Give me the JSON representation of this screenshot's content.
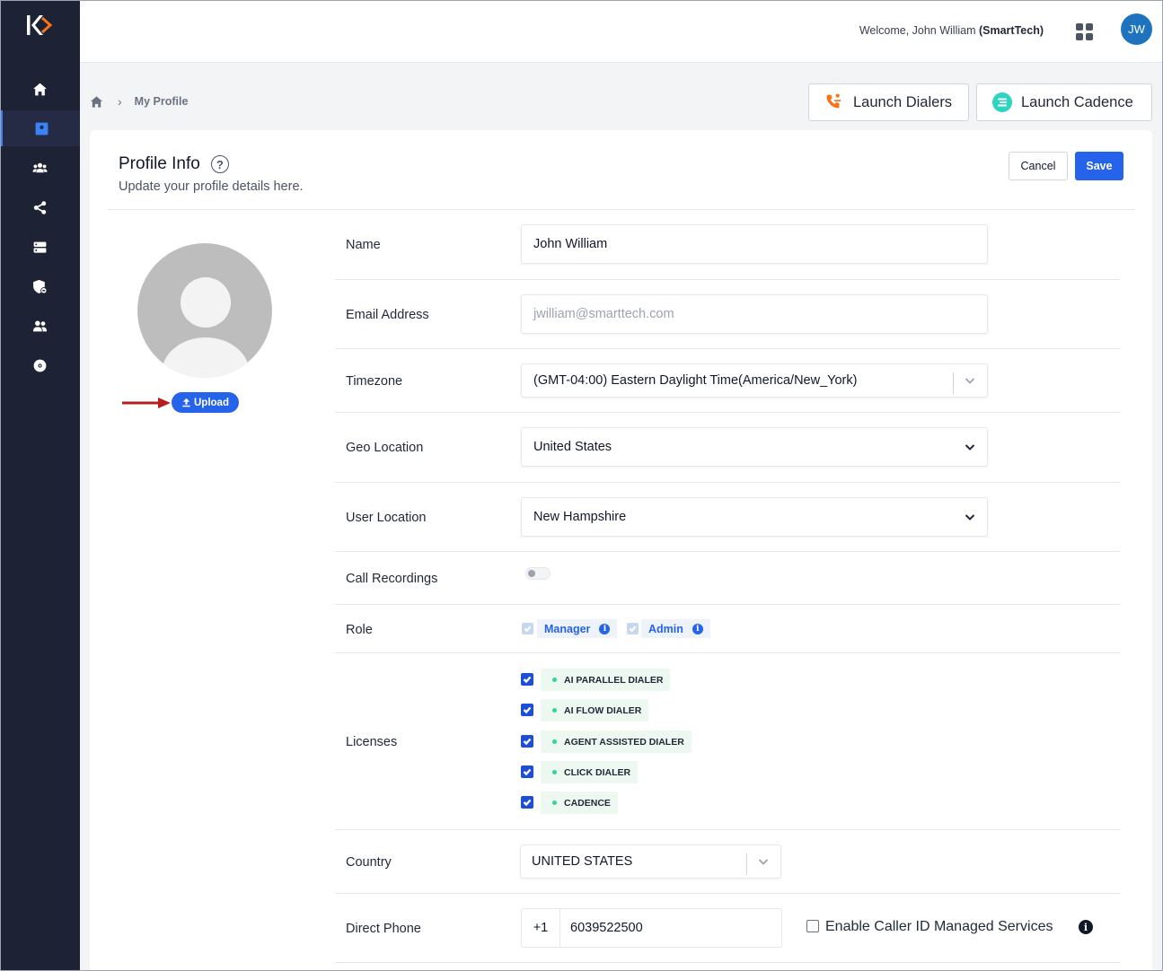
{
  "header": {
    "welcome_prefix": "Welcome, John William ",
    "welcome_org": "(SmartTech)",
    "avatar_initials": "JW"
  },
  "sidebar": {
    "items": [
      {
        "icon": "home-icon"
      },
      {
        "icon": "profile-icon",
        "active": true
      },
      {
        "icon": "users-group-icon"
      },
      {
        "icon": "share-icon"
      },
      {
        "icon": "server-icon"
      },
      {
        "icon": "shield-icon"
      },
      {
        "icon": "team-icon"
      },
      {
        "icon": "disc-icon"
      }
    ]
  },
  "breadcrumb": {
    "current": "My Profile"
  },
  "actions": {
    "launch_dialers": "Launch Dialers",
    "launch_cadence": "Launch Cadence",
    "cancel": "Cancel",
    "save": "Save"
  },
  "profile": {
    "title": "Profile Info",
    "help": "?",
    "subtitle": "Update your profile details here.",
    "upload_label": "Upload"
  },
  "form": {
    "name_label": "Name",
    "name_value": "John William",
    "email_label": "Email Address",
    "email_value": "jwilliam@smarttech.com",
    "timezone_label": "Timezone",
    "timezone_value": "(GMT-04:00) Eastern Daylight Time(America/New_York)",
    "geo_label": "Geo Location",
    "geo_value": "United States",
    "user_location_label": "User Location",
    "user_location_value": "New Hampshire",
    "call_recordings_label": "Call Recordings",
    "call_recordings_enabled": false,
    "role_label": "Role",
    "roles": [
      "Manager",
      "Admin"
    ],
    "licenses_label": "Licenses",
    "licenses": [
      "AI PARALLEL DIALER",
      "AI FLOW DIALER",
      "AGENT ASSISTED DIALER",
      "CLICK DIALER",
      "CADENCE"
    ],
    "country_label": "Country",
    "country_value": "UNITED STATES",
    "direct_phone_label": "Direct Phone",
    "phone_prefix": "+1",
    "phone_value": "6039522500",
    "caller_id_label": "Enable Caller ID Managed Services",
    "caller_id_checked": false
  },
  "colors": {
    "sidebar_bg": "#1e2235",
    "primary": "#2563eb",
    "license_tag_bg": "#edf8f1",
    "role_tag_bg": "#eef2f9"
  }
}
